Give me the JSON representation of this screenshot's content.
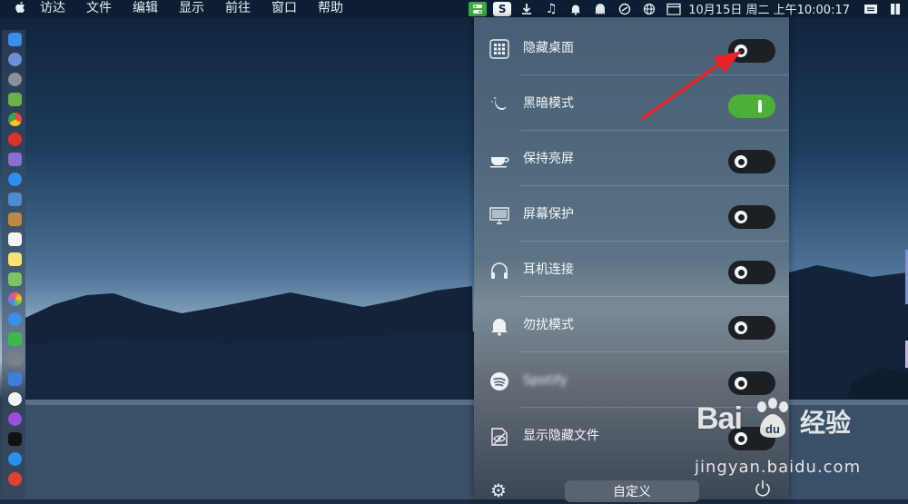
{
  "menubar": {
    "apple_icon": "apple-logo",
    "items": [
      "访达",
      "文件",
      "编辑",
      "显示",
      "前往",
      "窗口",
      "帮助"
    ],
    "clock": "10月15日 周二 上午10:00:17",
    "status_icons": [
      "control-center-icon",
      "s-app-icon",
      "download-icon",
      "music-note-icon",
      "bell-icon",
      "ghost-icon",
      "sync-icon",
      "globe-icon",
      "calendar-icon",
      "menu-equal-icon",
      "sidebar-icon"
    ]
  },
  "panel": {
    "rows": [
      {
        "label": "隐藏桌面",
        "icon": "grid-icon",
        "state": "off"
      },
      {
        "label": "黑暗模式",
        "icon": "moon-icon",
        "state": "on"
      },
      {
        "label": "保持亮屏",
        "icon": "coffee-cup-icon",
        "state": "off"
      },
      {
        "label": "屏幕保护",
        "icon": "monitor-icon",
        "state": "off"
      },
      {
        "label": "耳机连接",
        "icon": "headphones-icon",
        "state": "off"
      },
      {
        "label": "勿扰模式",
        "icon": "bell-icon",
        "state": "off"
      },
      {
        "label": "Spotify",
        "icon": "spotify-icon",
        "state": "off",
        "blurred": true
      },
      {
        "label": "显示隐藏文件",
        "icon": "eye-slash-icon",
        "state": "off"
      }
    ],
    "footer": {
      "custom_label": "自定义",
      "settings_icon": "gear-icon",
      "power_icon": "power-icon"
    }
  },
  "watermark": {
    "logo": "Bai",
    "logo_du": "du",
    "cn": "经验",
    "url": "jingyan.baidu.com"
  },
  "colors": {
    "toggle_on": "#4caf3a",
    "toggle_off": "#1c1f24",
    "arrow": "#e8232a",
    "menubar_bg": "#0d1e33"
  }
}
